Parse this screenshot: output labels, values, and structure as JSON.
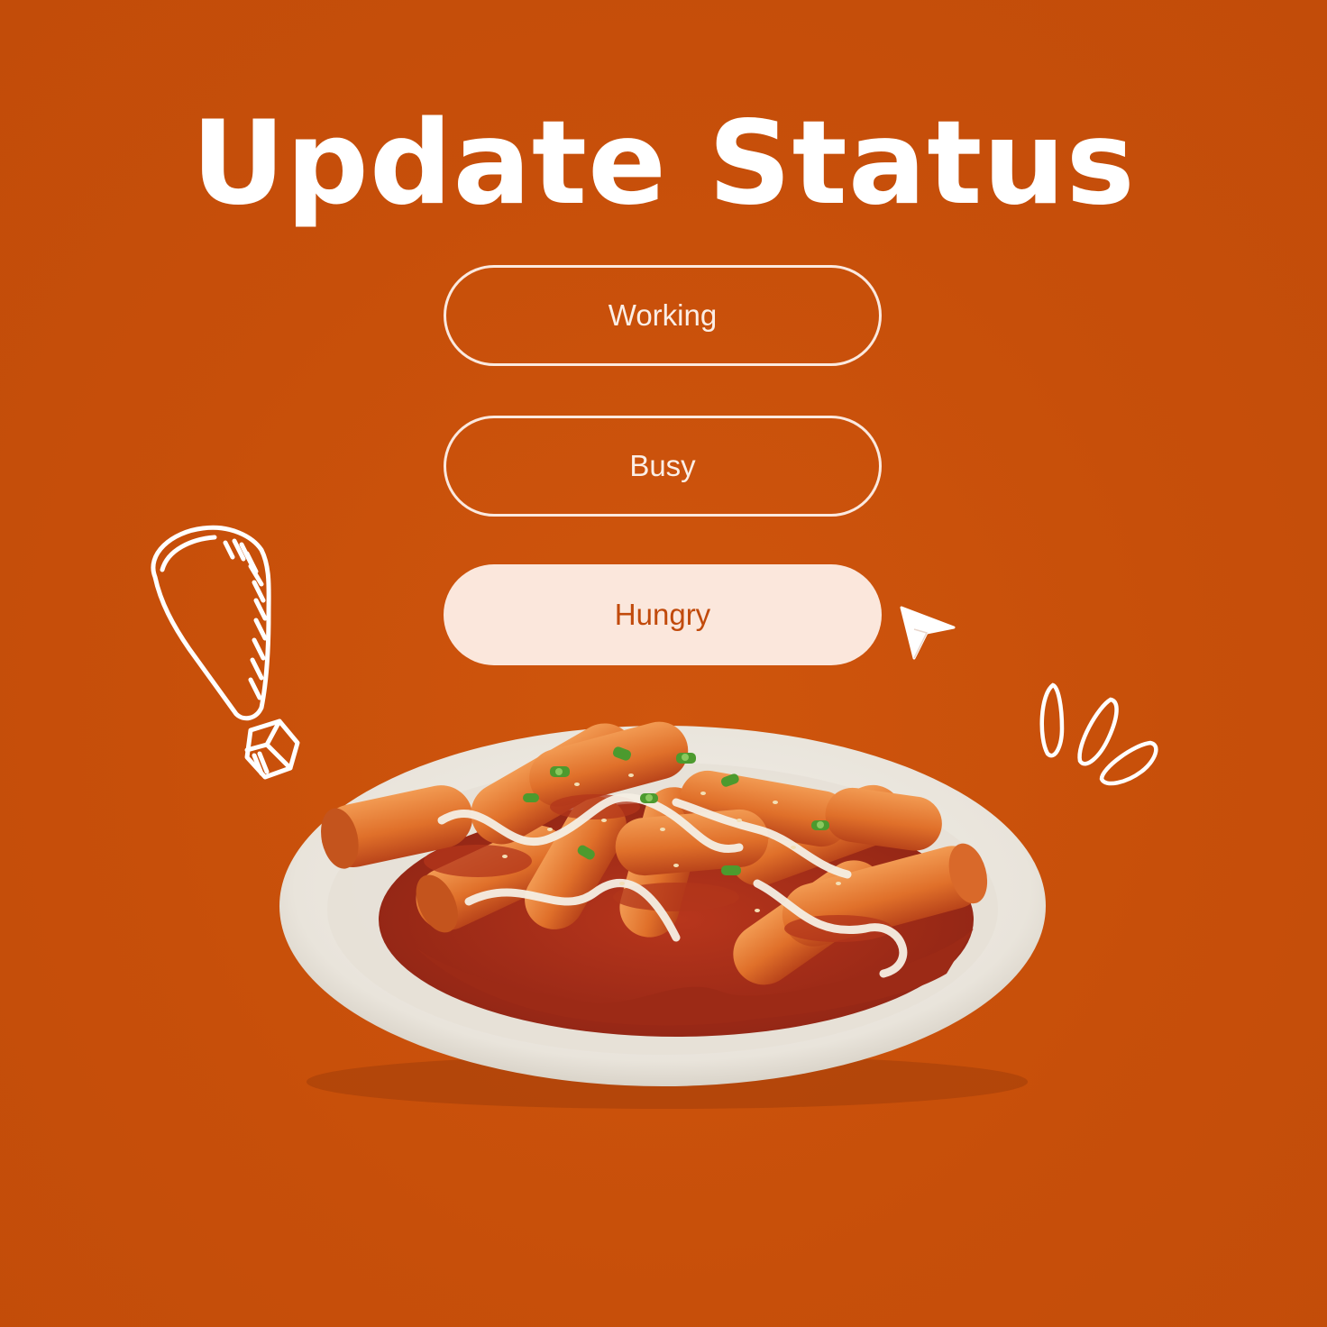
{
  "header": {
    "title": "Update Status"
  },
  "status_options": [
    {
      "label": "Working",
      "selected": false
    },
    {
      "label": "Busy",
      "selected": false
    },
    {
      "label": "Hungry",
      "selected": true
    }
  ],
  "colors": {
    "background": "#c9500b",
    "text_light": "#ffffff",
    "selected_fill": "#fbe7dc",
    "selected_text": "#c14a0b"
  },
  "icons": {
    "pointer": "cursor-arrow-icon",
    "exclamation": "exclamation-doodle-icon",
    "emphasis": "emphasis-lines-doodle-icon",
    "dish": "tteokbokki-plate-image"
  }
}
